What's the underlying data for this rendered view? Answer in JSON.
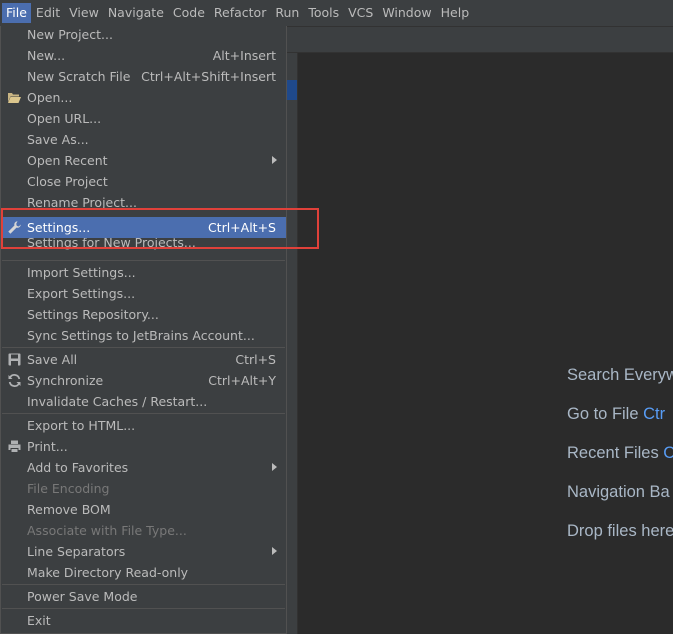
{
  "menubar": {
    "items": [
      "File",
      "Edit",
      "View",
      "Navigate",
      "Code",
      "Refactor",
      "Run",
      "Tools",
      "VCS",
      "Window",
      "Help"
    ],
    "active_index": 0
  },
  "file_menu": {
    "new_project": "New Project...",
    "new": "New...",
    "new_shortcut": "Alt+Insert",
    "new_scratch": "New Scratch File",
    "new_scratch_shortcut": "Ctrl+Alt+Shift+Insert",
    "open": "Open...",
    "open_url": "Open URL...",
    "save_as": "Save As...",
    "open_recent": "Open Recent",
    "close_project": "Close Project",
    "rename_project": "Rename Project...",
    "settings": "Settings...",
    "settings_shortcut": "Ctrl+Alt+S",
    "settings_new_projects": "Settings for New Projects...",
    "import_settings": "Import Settings...",
    "export_settings": "Export Settings...",
    "settings_repository": "Settings Repository...",
    "sync_settings": "Sync Settings to JetBrains Account...",
    "save_all": "Save All",
    "save_all_shortcut": "Ctrl+S",
    "synchronize": "Synchronize",
    "synchronize_shortcut": "Ctrl+Alt+Y",
    "invalidate_caches": "Invalidate Caches / Restart...",
    "export_html": "Export to HTML...",
    "print": "Print...",
    "add_to_favorites": "Add to Favorites",
    "file_encoding": "File Encoding",
    "remove_bom": "Remove BOM",
    "associate_file_type": "Associate with File Type...",
    "line_separators": "Line Separators",
    "make_read_only": "Make Directory Read-only",
    "power_save_mode": "Power Save Mode",
    "exit": "Exit"
  },
  "editor_hints": {
    "search_everywhere": "Search Everyw",
    "go_to_file": "Go to File",
    "go_to_file_shortcut": "Ctr",
    "recent_files": "Recent Files",
    "recent_files_shortcut": "C",
    "navigation_bar": "Navigation Ba",
    "drop_files": "Drop files here"
  },
  "colors": {
    "menu_bg": "#3c3f41",
    "editor_bg": "#2b2b2b",
    "highlight": "#4b6eaf",
    "annotation_box": "#e0413a",
    "shortcut_blue": "#589df6"
  },
  "icons": [
    "folder-open-icon",
    "wrench-icon",
    "save-icon",
    "sync-icon",
    "print-icon",
    "submenu-arrow-icon"
  ]
}
